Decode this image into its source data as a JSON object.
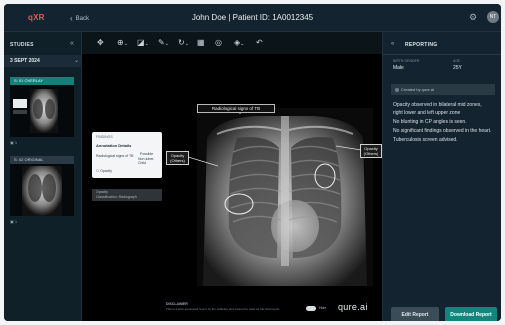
{
  "header": {
    "logo": "qXR",
    "back_label": "Back",
    "title": "John Doe | Patient ID: 1A0012345",
    "avatar_initials": "NT"
  },
  "sidebar": {
    "heading": "STUDIES",
    "date": "3 SEPT 2024",
    "series": [
      {
        "label": "S: 01 OVERLAY",
        "count": "1",
        "active": true
      },
      {
        "label": "S: 02 ORIGINAL",
        "count": "1",
        "active": false
      }
    ]
  },
  "toolbar": {
    "tools": [
      "move-icon",
      "zoom-icon",
      "contrast-icon",
      "annotate-icon",
      "rotate-icon",
      "grid-icon",
      "circle-icon",
      "layers-icon",
      "undo-icon"
    ]
  },
  "viewer": {
    "annotation_title": "Radiological signs of TB",
    "tag_left": "Opacity (Others)",
    "tag_right": "Opacity (Others)",
    "popup": {
      "header": "FINDINGS",
      "title": "Annotation Details",
      "row_label": "Radiological signs of TB",
      "row_value": "Possible",
      "row_sub": "Non-tuber. Child",
      "tag_label": "Opacity",
      "footer_label": "Opacity",
      "footer_sub": "Classification: Radiograph"
    },
    "disclaimer_head": "DISCLAIMER",
    "disclaimer_body": "This is a auto generated report by the software and cannot be used as the final report.",
    "toggle_label": "Hide",
    "brand": "qure.ai"
  },
  "panel": {
    "title": "REPORTING",
    "meta": [
      {
        "label": "BIRTH GENDER",
        "value": "Male"
      },
      {
        "label": "AGE",
        "value": "25Y"
      }
    ],
    "created_by": "Created by qure.ai",
    "report_lines": [
      "Opacity observed in bilateral mid zones,",
      "right lower and left upper zone",
      "No blunting in CP angles is seen.",
      "No significant findings observed in the heart.",
      "Tuberculosis screen advised."
    ],
    "edit_button": "Edit Report",
    "download_button": "Download Report"
  },
  "colors": {
    "accent": "#12857d",
    "logo": "#e25b5b",
    "background": "#0f1b24"
  }
}
